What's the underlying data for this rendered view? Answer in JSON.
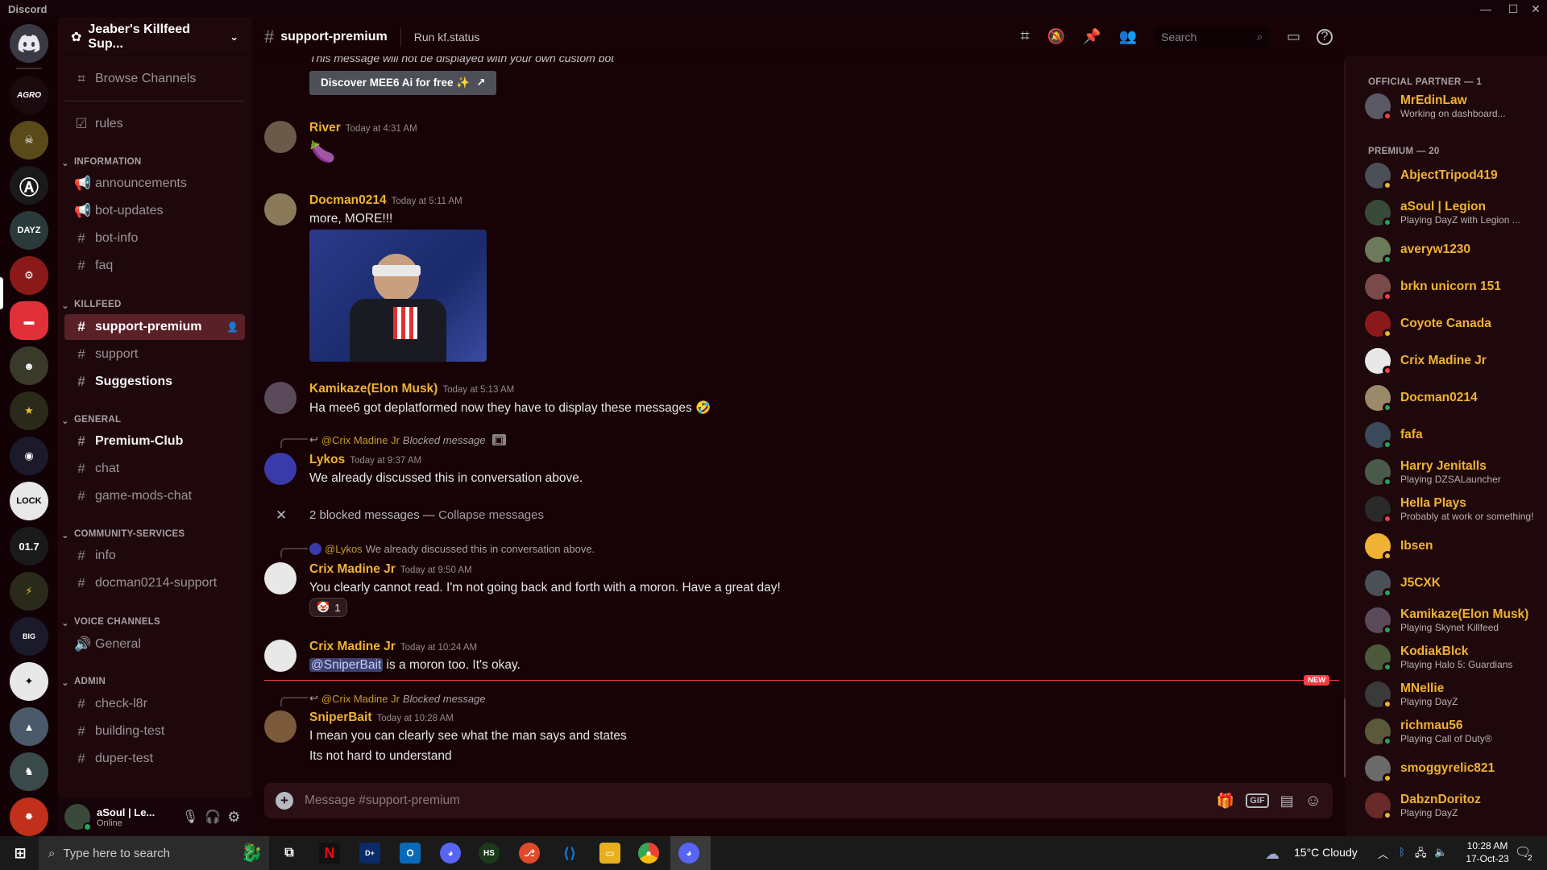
{
  "window": {
    "app_title": "Discord",
    "controls": [
      "—",
      "☐",
      "✕"
    ]
  },
  "server": {
    "name": "Jeaber's Killfeed Sup..."
  },
  "sidebar": {
    "browse": "Browse Channels",
    "rules": "rules",
    "categories": {
      "information": "INFORMATION",
      "killfeed": "KILLFEED",
      "general": "GENERAL",
      "community": "COMMUNITY-SERVICES",
      "voice": "VOICE CHANNELS",
      "admin": "ADMIN"
    },
    "channels": {
      "announcements": "announcements",
      "bot_updates": "bot-updates",
      "bot_info": "bot-info",
      "faq": "faq",
      "support_premium": "support-premium",
      "support": "support",
      "suggestions": "Suggestions",
      "premium_club": "Premium-Club",
      "chat": "chat",
      "game_mods_chat": "game-mods-chat",
      "info": "info",
      "docman_support": "docman0214-support",
      "voice_general": "General",
      "check_l8r": "check-l8r",
      "building_test": "building-test",
      "duper_test": "duper-test"
    }
  },
  "user_panel": {
    "name": "aSoul | Le...",
    "status": "Online"
  },
  "header": {
    "channel": "support-premium",
    "topic": "Run kf.status",
    "search_placeholder": "Search"
  },
  "messages": {
    "mee6_note": "This message will not be displayed with your own custom bot",
    "mee6_button": "Discover MEE6 Ai for free ✨",
    "river": {
      "name": "River",
      "time": "Today at 4:31 AM",
      "emoji": "🍆"
    },
    "docman": {
      "name": "Docman0214",
      "time": "Today at 5:11 AM",
      "text": "more, MORE!!!"
    },
    "kamikaze": {
      "name": "Kamikaze(Elon Musk)",
      "time": "Today at 5:13 AM",
      "text": "Ha mee6 got deplatformed now they have to display these messages 🤣"
    },
    "lykos_reply": {
      "to": "@Crix Madine Jr",
      "text": "Blocked message"
    },
    "lykos": {
      "name": "Lykos",
      "time": "Today at 9:37 AM",
      "text": "We already discussed this in conversation above."
    },
    "blocked": {
      "count_text": "2 blocked messages —",
      "action": "Collapse messages"
    },
    "crix1_reply": {
      "to": "@Lykos",
      "text": "We already discussed this in conversation above."
    },
    "crix1": {
      "name": "Crix Madine Jr",
      "time": "Today at 9:50 AM",
      "text": "You clearly cannot read. I'm not going back and forth with a moron. Have a great day!",
      "reaction_emoji": "🤡",
      "reaction_count": "1"
    },
    "crix2": {
      "name": "Crix Madine Jr",
      "time": "Today at 10:24 AM",
      "mention": "@SniperBait",
      "text": " is a moron too. It's okay."
    },
    "new_badge": "NEW",
    "sniper_reply": {
      "to": "@Crix Madine Jr",
      "text": "Blocked message"
    },
    "sniper": {
      "name": "SniperBait",
      "time": "Today at 10:28 AM",
      "line1": "I mean you can clearly see what the man says and states",
      "line2": "Its not hard to understand"
    }
  },
  "composer": {
    "placeholder": "Message #support-premium",
    "gif": "GIF"
  },
  "members": {
    "partner_header": "OFFICIAL PARTNER — 1",
    "premium_header": "PREMIUM — 20",
    "list": [
      {
        "name": "MrEdinLaw",
        "activity": "Working on dashboard...",
        "color": "#f0b232",
        "status": "#f23f43",
        "avatar": "#5a5a66"
      },
      {
        "name": "AbjectTripod419",
        "activity": "",
        "color": "#f0b232",
        "status": "#f0b232",
        "avatar": "#4a4f58"
      },
      {
        "name": "aSoul | Legion",
        "activity": "Playing DayZ with Legion ...",
        "color": "#f0b232",
        "status": "#23a55a",
        "avatar": "#3a4a3a"
      },
      {
        "name": "averyw1230",
        "activity": "",
        "color": "#f0b232",
        "status": "#23a55a",
        "avatar": "#6a7a5a"
      },
      {
        "name": "brkn unicorn 151",
        "activity": "",
        "color": "#f0b232",
        "status": "#f23f43",
        "avatar": "#7a4a4a"
      },
      {
        "name": "Coyote Canada",
        "activity": "",
        "color": "#f0b232",
        "status": "#f0b232",
        "avatar": "#8a1a1a"
      },
      {
        "name": "Crix Madine Jr",
        "activity": "",
        "color": "#f0b232",
        "status": "#f23f43",
        "avatar": "#e8e8e8"
      },
      {
        "name": "Docman0214",
        "activity": "",
        "color": "#f0b232",
        "status": "#23a55a",
        "avatar": "#9a8a6a"
      },
      {
        "name": "fafa",
        "activity": "",
        "color": "#f0b232",
        "status": "#23a55a",
        "avatar": "#3a4a5a"
      },
      {
        "name": "Harry Jenitalls",
        "activity": "Playing DZSALauncher",
        "color": "#f0b232",
        "status": "#23a55a",
        "avatar": "#4a5a4a"
      },
      {
        "name": "Hella Plays",
        "activity": "Probably at work or something!",
        "color": "#f0b232",
        "status": "#f23f43",
        "avatar": "#2a2a2a"
      },
      {
        "name": "Ibsen",
        "activity": "",
        "color": "#f0b232",
        "status": "#f0b232",
        "avatar": "#f0b232"
      },
      {
        "name": "J5CXK",
        "activity": "",
        "color": "#f0b232",
        "status": "#23a55a",
        "avatar": "#4a5058"
      },
      {
        "name": "Kamikaze(Elon Musk)",
        "activity": "Playing Skynet Killfeed",
        "color": "#f0b232",
        "status": "#23a55a",
        "avatar": "#5a4a5a"
      },
      {
        "name": "KodiakBlck",
        "activity": "Playing Halo 5: Guardians",
        "color": "#f0b232",
        "status": "#23a55a",
        "avatar": "#4a5a3a"
      },
      {
        "name": "MNellie",
        "activity": "Playing DayZ",
        "color": "#f0b232",
        "status": "#f0b232",
        "avatar": "#3a3a3a"
      },
      {
        "name": "richmau56",
        "activity": "Playing Call of Duty®",
        "color": "#f0b232",
        "status": "#23a55a",
        "avatar": "#5a5a3a"
      },
      {
        "name": "smoggyrelic821",
        "activity": "",
        "color": "#f0b232",
        "status": "#f0b232",
        "avatar": "#6a6a6a"
      },
      {
        "name": "DabznDoritoz",
        "activity": "Playing DayZ",
        "color": "#f0b232",
        "status": "#f0b232",
        "avatar": "#6a2a2a"
      }
    ]
  },
  "taskbar": {
    "search_placeholder": "Type here to search",
    "weather": "15°C  Cloudy",
    "time": "10:28 AM",
    "date": "17-Oct-23",
    "notif_count": "2"
  }
}
